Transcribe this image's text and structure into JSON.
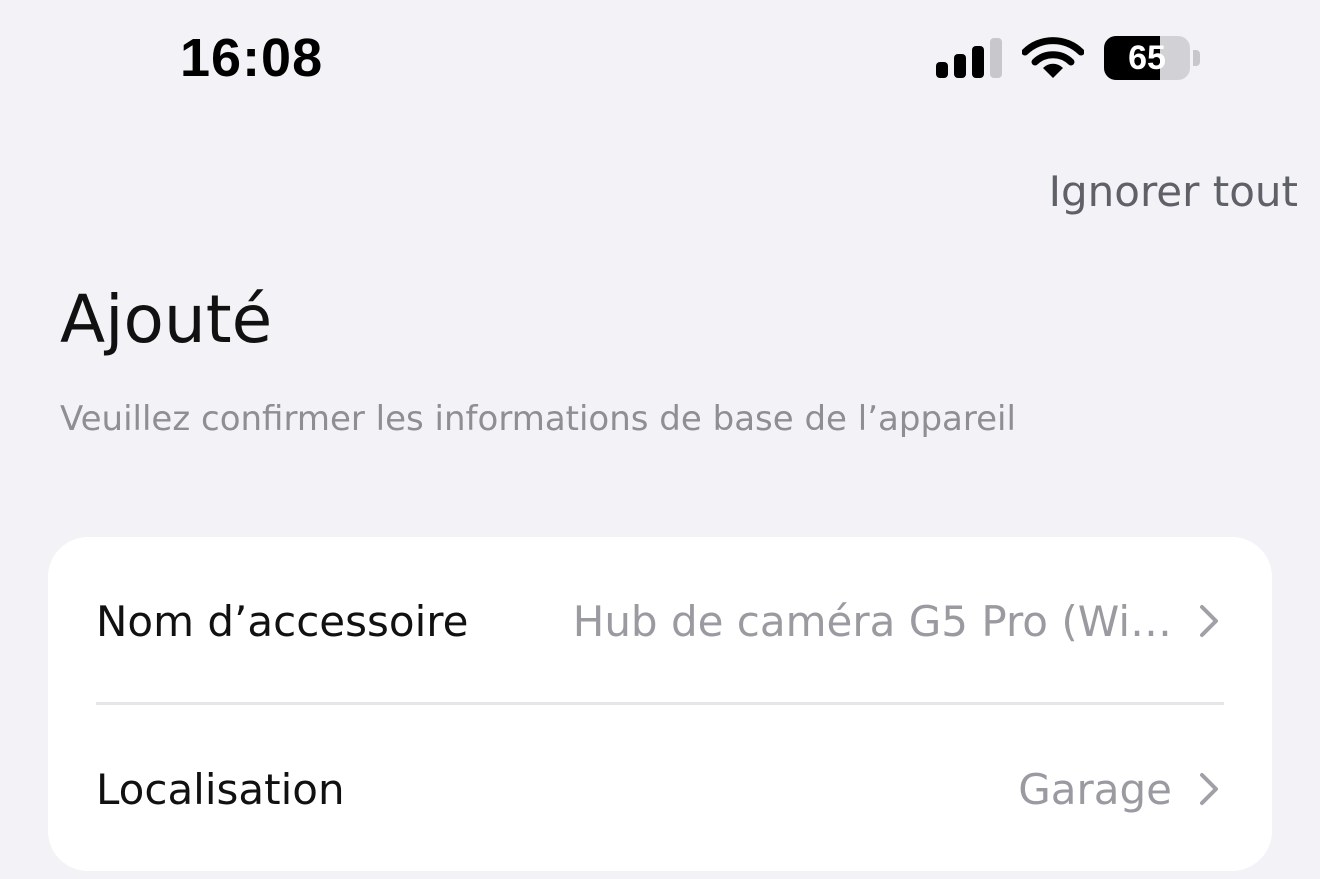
{
  "status_bar": {
    "time": "16:08",
    "battery_percent": "65",
    "battery_level": 0.65,
    "icons": [
      "signal-icon",
      "wifi-icon",
      "battery-icon"
    ]
  },
  "header": {
    "ignore_all_label": "Ignorer tout"
  },
  "main": {
    "title": "Ajouté",
    "subtitle": "Veuillez confirmer les informations de base de l’appareil"
  },
  "settings": {
    "items": [
      {
        "label": "Nom d’accessoire",
        "value": "Hub de caméra G5 Pro (Wi…"
      },
      {
        "label": "Localisation",
        "value": "Garage"
      }
    ]
  },
  "colors": {
    "background": "#f2f2f7",
    "card": "#ffffff",
    "secondary_text": "#9a9aa0",
    "divider": "#e5e5ea"
  }
}
